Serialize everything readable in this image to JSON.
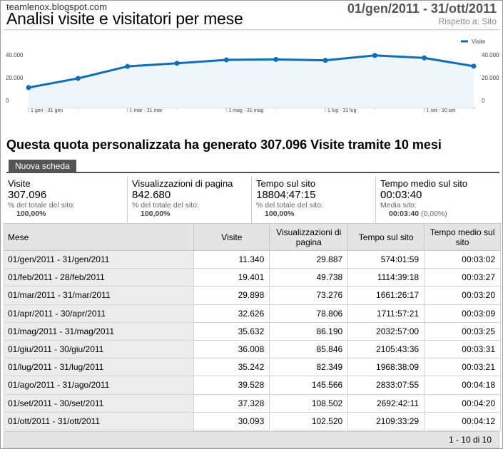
{
  "header": {
    "site": "teamlenox.blogspot.com",
    "title": "Analisi visite e visitatori per mese",
    "date_range": "01/gen/2011 - 31/ott/2011",
    "compare_label": "Rispetto a: Sito"
  },
  "chart_data": {
    "type": "area",
    "series": [
      {
        "name": "Visite",
        "values": [
          11340,
          19401,
          29898,
          32626,
          35632,
          36008,
          35242,
          39528,
          37328,
          30093
        ]
      }
    ],
    "y_ticks": [
      "40.000",
      "20.000",
      "0"
    ],
    "ylim": [
      0,
      40000
    ],
    "x_tick_labels": [
      "1 gen - 31 gen",
      "1 mar - 31 mar",
      "1 mag - 31 mag",
      "1 lug - 31 lug",
      "1 set - 30 set"
    ],
    "legend": "Visite",
    "line_color": "#0a6fc2",
    "fill_color": "#eef5fb",
    "grid": false
  },
  "subtitle": "Questa quota personalizzata ha generato 307.096 Visite tramite 10 mesi",
  "tab": {
    "label": "Nuova scheda"
  },
  "metrics": [
    {
      "label": "Visite",
      "value": "307.096",
      "sub": "% del totale del sito:",
      "sub2": "100,00%"
    },
    {
      "label": "Visualizzazioni di pagina",
      "value": "842.680",
      "sub": "% del totale del sito:",
      "sub2": "100,00%"
    },
    {
      "label": "Tempo sul sito",
      "value": "18804:47:15",
      "sub": "% del totale del sito:",
      "sub2": "100,00%"
    },
    {
      "label": "Tempo medio sul sito",
      "value": "00:03:40",
      "sub": "Media sito:",
      "sub2_bold": "00:03:40",
      "sub2_rest": " (0,00%)"
    }
  ],
  "table": {
    "columns": [
      "Mese",
      "Visite",
      "Visualizzazioni di pagina",
      "Tempo sul sito",
      "Tempo medio sul sito"
    ],
    "rows": [
      [
        "01/gen/2011 - 31/gen/2011",
        "11.340",
        "29.887",
        "574:01:59",
        "00:03:02"
      ],
      [
        "01/feb/2011 - 28/feb/2011",
        "19.401",
        "49.738",
        "1114:39:18",
        "00:03:27"
      ],
      [
        "01/mar/2011 - 31/mar/2011",
        "29.898",
        "73.276",
        "1661:26:17",
        "00:03:20"
      ],
      [
        "01/apr/2011 - 30/apr/2011",
        "32.626",
        "78.806",
        "1711:57:21",
        "00:03:09"
      ],
      [
        "01/mag/2011 - 31/mag/2011",
        "35.632",
        "86.190",
        "2032:57:00",
        "00:03:25"
      ],
      [
        "01/giu/2011 - 30/giu/2011",
        "36.008",
        "85.846",
        "2105:43:36",
        "00:03:31"
      ],
      [
        "01/lug/2011 - 31/lug/2011",
        "35.242",
        "82.349",
        "1968:38:09",
        "00:03:21"
      ],
      [
        "01/ago/2011 - 31/ago/2011",
        "39.528",
        "145.566",
        "2833:07:55",
        "00:04:18"
      ],
      [
        "01/set/2011 - 30/set/2011",
        "37.328",
        "108.502",
        "2692:42:11",
        "00:04:20"
      ],
      [
        "01/ott/2011 - 31/ott/2011",
        "30.093",
        "102.520",
        "2109:33:29",
        "00:04:12"
      ]
    ]
  },
  "pager": {
    "label": "1 - 10 di 10"
  }
}
